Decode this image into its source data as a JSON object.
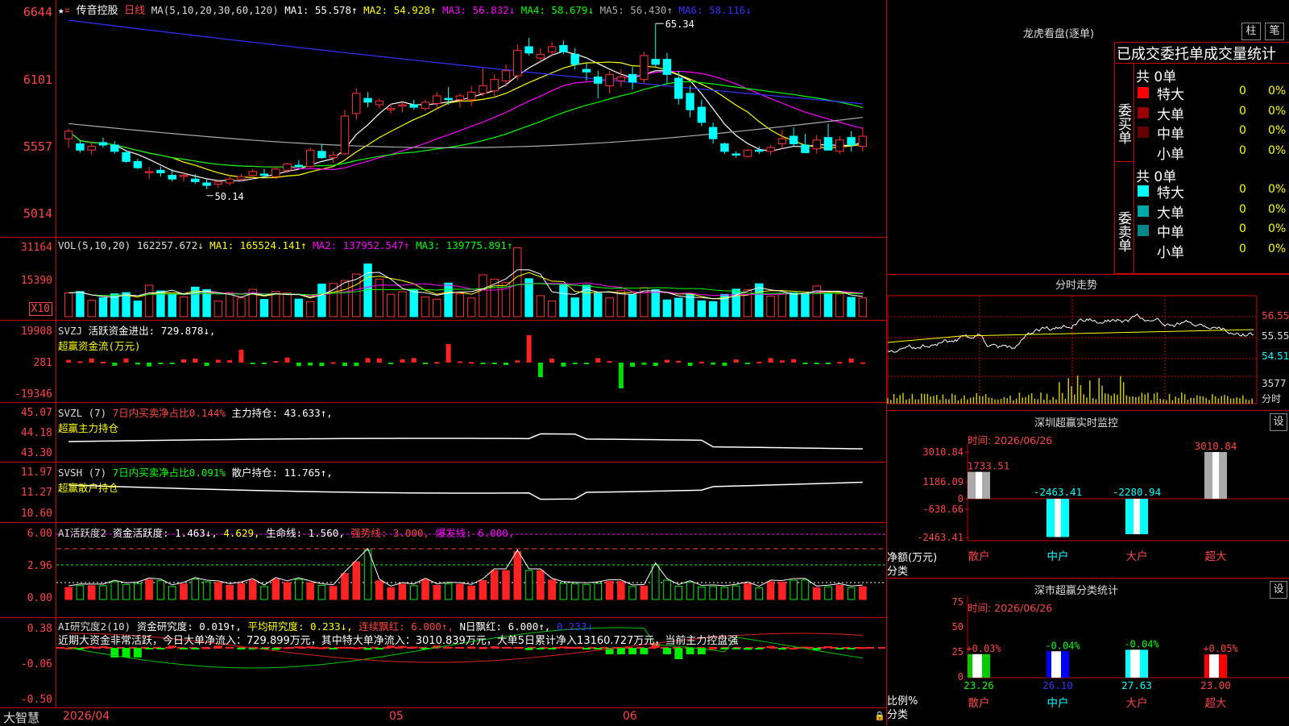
{
  "main": {
    "stock_name": "传音控股",
    "period": "日线",
    "ma_label": "MA(5,10,20,30,60,120)",
    "ma_values": [
      {
        "name": "MA1",
        "value": "55.578",
        "arrow": "↑",
        "color": "#ffffff"
      },
      {
        "name": "MA2",
        "value": "54.928",
        "arrow": "↑",
        "color": "#ffff00"
      },
      {
        "name": "MA3",
        "value": "56.832",
        "arrow": "↓",
        "color": "#ff00ff"
      },
      {
        "name": "MA4",
        "value": "58.679",
        "arrow": "↓",
        "color": "#00ff00"
      },
      {
        "name": "MA5",
        "value": "56.430",
        "arrow": "↑",
        "color": "#aaaaaa"
      },
      {
        "name": "MA6",
        "value": "58.116",
        "arrow": "↓",
        "color": "#3333ff"
      }
    ],
    "y_ticks": [
      "6644",
      "6101",
      "5557",
      "5014"
    ],
    "annotation_high": "65.34",
    "annotation_low": "50.14"
  },
  "volume": {
    "label": "VOL(5,10,20)",
    "value": "162257.672↓",
    "ma1": "MA1: 165524.141↑",
    "ma2": "MA2: 137952.547↑",
    "ma3": "MA3: 139775.891↑",
    "y_ticks": [
      "31164",
      "15390"
    ],
    "unit": "X10"
  },
  "svzj": {
    "label": "SVZJ",
    "active_label": "活跃资金进出: 729.878↓,",
    "sub_label": "超赢资金流(万元)",
    "y_ticks": [
      "19908",
      "281",
      "-19346"
    ]
  },
  "svzl": {
    "label": "SVZL (7)",
    "ratio_label": "7日内买卖净占比0.144%",
    "hold_label": "主力持仓: 43.633↑,",
    "sub_label": "超赢主力持仓",
    "y_ticks": [
      "45.07",
      "44.18",
      "43.30"
    ]
  },
  "svsh": {
    "label": "SVSH (7)",
    "ratio_label": "7日内买卖净占比0.091%",
    "hold_label": "散户持仓: 11.765↑,",
    "sub_label": "超赢散户持仓",
    "y_ticks": [
      "11.97",
      "11.27",
      "10.60"
    ]
  },
  "ai_active": {
    "label": "AI活跃度2",
    "fund": "资金活跃度: 1.463↓,",
    "v2": "4.629,",
    "life": "生命线: 1.560,",
    "strong": "强势线: 3.000,",
    "burst": "爆发线: 6.000,",
    "y_ticks": [
      "6.00",
      "2.96",
      "0.00"
    ]
  },
  "ai_research": {
    "label": "AI研究度2(10)",
    "fund": "资金研究度: 0.019↑,",
    "avg": "平均研究度: 0.233↓,",
    "red": "连续飘红: 6.000↑,",
    "nred": "N日飘红: 6.000↑,",
    "last": "0.233↓",
    "summary": "近期大资金非常活跃，今日大单净流入：729.899万元，其中特大单净流入：3010.839万元，大单5日累计净入13160.727万元，当前主力控盘强",
    "y_ticks": [
      "0.38",
      "-0.06",
      "-0.50"
    ]
  },
  "bottom": {
    "brand": "大智慧",
    "date": "2026/04",
    "m05": "05",
    "m06": "06"
  },
  "right": {
    "lhb_title": "龙虎看盘(逐单)",
    "btn_col": "柱",
    "btn_pen": "笔",
    "stats_title": "已成交委托单成交量统计",
    "buy_label": "委买单",
    "sell_label": "委卖单",
    "buy_total": "共 0单",
    "sell_total": "共 0单",
    "buy_rows": [
      {
        "name": "特大",
        "count": "0",
        "pct": "0%",
        "color": "#ff0000"
      },
      {
        "name": "大单",
        "count": "0",
        "pct": "0%",
        "color": "#990000"
      },
      {
        "name": "中单",
        "count": "0",
        "pct": "0%",
        "color": "#660000"
      },
      {
        "name": "小单",
        "count": "0",
        "pct": "0%",
        "color": "#000000"
      }
    ],
    "sell_rows": [
      {
        "name": "特大",
        "count": "0",
        "pct": "0%",
        "color": "#00ffff"
      },
      {
        "name": "大单",
        "count": "0",
        "pct": "0%",
        "color": "#00aaaa"
      },
      {
        "name": "中单",
        "count": "0",
        "pct": "0%",
        "color": "#008888"
      },
      {
        "name": "小单",
        "count": "0",
        "pct": "0%",
        "color": "#000000"
      }
    ],
    "intraday_title": "分时走势",
    "intraday_prices": [
      "56.55",
      "55.55",
      "54.51"
    ],
    "intraday_vol": "3577",
    "intraday_unit": "分时",
    "sz_monitor_title": "深圳超赢实时监控",
    "setting": "设",
    "time_label": "时间: 2026/06/26",
    "net_y": [
      "3010.84",
      "1186.09",
      "0",
      "-638.66",
      "-2463.41"
    ],
    "net_axis": "净额(万元)",
    "category_axis": "分类",
    "net_labels": [
      "1733.51",
      "-2463.41",
      "-2280.94",
      "3010.84"
    ],
    "net_values": [
      1733.51,
      -2463.41,
      -2280.94,
      3010.84
    ],
    "categories": [
      "散户",
      "中户",
      "大户",
      "超大"
    ],
    "class_title": "深市超赢分类统计",
    "ratio_y": [
      "75",
      "50",
      "25",
      "0"
    ],
    "ratio_axis": "比例%",
    "ratio_values": [
      23.26,
      26.1,
      27.63,
      23.0
    ],
    "ratio_value_labels": [
      "23.26",
      "26.10",
      "27.63",
      "23.00"
    ],
    "ratio_changes": [
      "+0.03%",
      "-0.04%",
      "-0.04%",
      "+0.05%"
    ]
  },
  "chart_data": {
    "type": "candlestick",
    "dates_visible": [
      "2026/04",
      "05",
      "06"
    ],
    "y_range": [
      50.14,
      66.44
    ],
    "high": 65.34,
    "low": 50.14,
    "candles": [
      [
        56.2,
        57.0,
        55.5,
        56.8
      ],
      [
        55.8,
        56.1,
        55.1,
        55.3
      ],
      [
        55.3,
        56.0,
        54.9,
        55.6
      ],
      [
        55.9,
        56.3,
        55.5,
        55.7
      ],
      [
        55.7,
        56.0,
        55.0,
        55.2
      ],
      [
        55.1,
        55.3,
        54.3,
        54.4
      ],
      [
        54.4,
        54.6,
        53.8,
        53.9
      ],
      [
        53.5,
        54.0,
        53.0,
        53.6
      ],
      [
        53.7,
        54.0,
        53.2,
        53.5
      ],
      [
        53.3,
        53.8,
        52.8,
        53.0
      ],
      [
        53.2,
        53.6,
        52.8,
        53.3
      ],
      [
        53.0,
        53.4,
        52.6,
        52.8
      ],
      [
        52.7,
        53.0,
        52.2,
        52.5
      ],
      [
        52.6,
        52.9,
        52.3,
        52.8
      ],
      [
        52.7,
        53.3,
        52.5,
        53.0
      ],
      [
        53.0,
        53.4,
        52.8,
        53.2
      ],
      [
        53.3,
        53.8,
        53.0,
        53.6
      ],
      [
        53.4,
        53.8,
        53.1,
        53.3
      ],
      [
        53.2,
        54.0,
        53.0,
        53.8
      ],
      [
        53.7,
        54.3,
        53.5,
        54.2
      ],
      [
        54.1,
        54.5,
        53.9,
        54.0
      ],
      [
        54.0,
        55.5,
        53.9,
        55.3
      ],
      [
        55.2,
        55.8,
        54.6,
        54.7
      ],
      [
        54.7,
        55.2,
        54.3,
        54.9
      ],
      [
        55.0,
        58.5,
        54.9,
        58.0
      ],
      [
        58.2,
        60.2,
        57.7,
        59.8
      ],
      [
        59.4,
        59.9,
        58.7,
        59.1
      ],
      [
        58.9,
        59.4,
        58.6,
        59.2
      ],
      [
        58.5,
        59.0,
        58.2,
        58.6
      ],
      [
        58.8,
        59.2,
        58.3,
        58.9
      ],
      [
        58.9,
        59.3,
        58.5,
        58.7
      ],
      [
        58.6,
        59.3,
        58.4,
        59.1
      ],
      [
        59.0,
        59.9,
        58.6,
        59.6
      ],
      [
        59.4,
        60.3,
        58.9,
        59.3
      ],
      [
        59.3,
        59.8,
        58.7,
        59.6
      ],
      [
        59.3,
        60.4,
        58.8,
        59.9
      ],
      [
        59.8,
        61.8,
        59.6,
        60.4
      ],
      [
        60.0,
        61.3,
        59.6,
        60.9
      ],
      [
        60.8,
        62.1,
        60.3,
        61.6
      ],
      [
        61.2,
        63.7,
        60.8,
        63.2
      ],
      [
        63.5,
        64.2,
        62.8,
        63.0
      ],
      [
        62.6,
        63.4,
        62.3,
        62.9
      ],
      [
        63.1,
        63.9,
        62.8,
        63.5
      ],
      [
        63.6,
        64.0,
        62.9,
        63.1
      ],
      [
        62.9,
        63.4,
        61.7,
        62.1
      ],
      [
        61.7,
        62.2,
        60.8,
        61.5
      ],
      [
        61.1,
        61.6,
        59.4,
        60.6
      ],
      [
        60.4,
        61.6,
        59.8,
        61.3
      ],
      [
        60.8,
        61.7,
        60.3,
        61.1
      ],
      [
        61.3,
        61.9,
        60.1,
        60.7
      ],
      [
        60.9,
        63.1,
        60.6,
        62.8
      ],
      [
        62.5,
        65.34,
        61.9,
        62.1
      ],
      [
        62.5,
        63.0,
        60.6,
        61.3
      ],
      [
        61.0,
        61.6,
        58.9,
        59.4
      ],
      [
        59.8,
        60.4,
        57.9,
        58.5
      ],
      [
        58.7,
        59.3,
        57.2,
        57.5
      ],
      [
        57.1,
        57.5,
        55.8,
        56.2
      ],
      [
        55.8,
        55.9,
        55.0,
        55.2
      ],
      [
        55.0,
        55.2,
        54.7,
        54.9
      ],
      [
        54.8,
        55.4,
        54.7,
        55.3
      ],
      [
        55.3,
        55.6,
        55.0,
        55.2
      ],
      [
        55.2,
        55.7,
        54.9,
        55.5
      ],
      [
        55.8,
        56.9,
        55.4,
        56.2
      ],
      [
        56.4,
        57.1,
        55.6,
        55.8
      ],
      [
        55.7,
        56.6,
        55.1,
        55.1
      ],
      [
        55.4,
        56.5,
        55.0,
        56.1
      ],
      [
        56.3,
        57.4,
        55.4,
        55.3
      ],
      [
        55.2,
        56.4,
        55.0,
        56.1
      ],
      [
        56.3,
        56.8,
        55.2,
        55.7
      ],
      [
        55.6,
        57.1,
        55.2,
        56.4
      ]
    ]
  }
}
